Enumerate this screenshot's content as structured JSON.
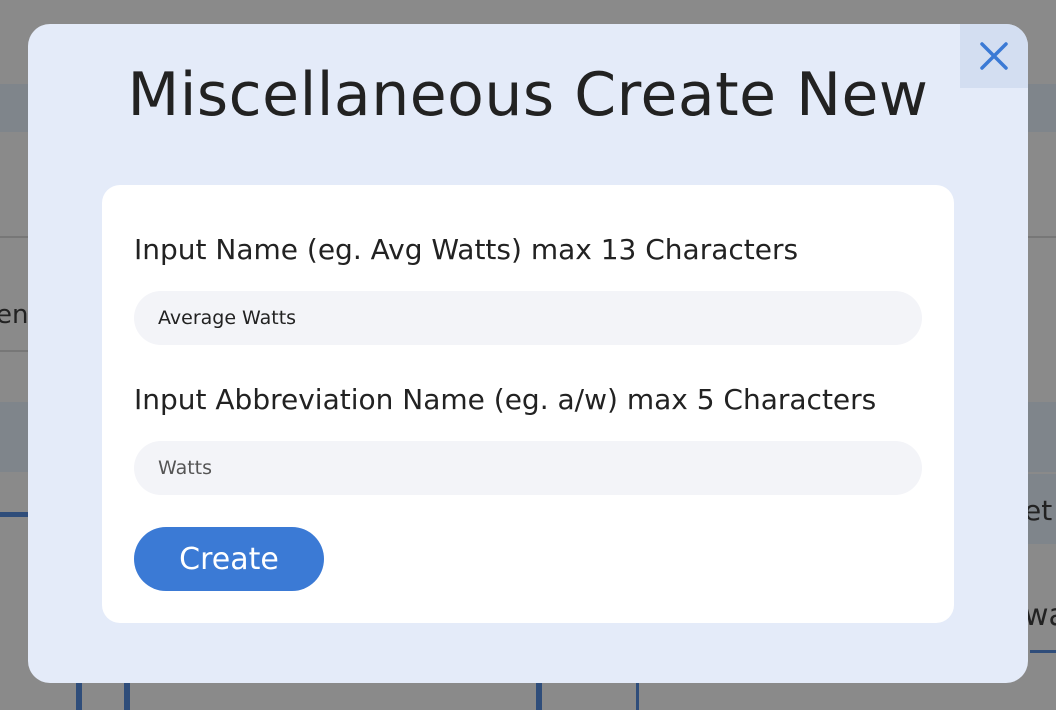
{
  "modal": {
    "title": "Miscellaneous Create New",
    "close_icon": "close-icon"
  },
  "form": {
    "name_label": "Input Name (eg. Avg Watts) max 13 Characters",
    "name_value": "Average Watts",
    "abbr_label": "Input Abbreviation Name (eg. a/w) max 5 Characters",
    "abbr_value": "Watts",
    "create_label": "Create"
  },
  "background": {
    "left_fragment": "en",
    "right_fragment_top": "et",
    "right_fragment_bottom": "wa"
  },
  "colors": {
    "accent": "#3b7ad5",
    "modal_bg": "#e4ebf9",
    "overlay": "#8a8a8a"
  }
}
